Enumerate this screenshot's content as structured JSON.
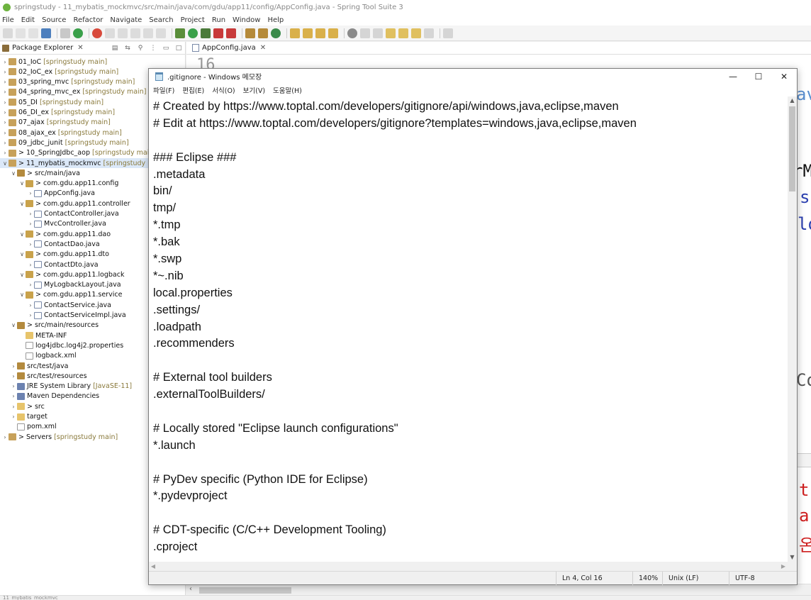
{
  "ide": {
    "title": "springstudy - 11_mybatis_mockmvc/src/main/java/com/gdu/app11/config/AppConfig.java - Spring Tool Suite 3",
    "menu": [
      "File",
      "Edit",
      "Source",
      "Refactor",
      "Navigate",
      "Search",
      "Project",
      "Run",
      "Window",
      "Help"
    ],
    "package_explorer": {
      "tab_label": "Package Explorer",
      "tree": [
        {
          "label": "01_IoC",
          "dec": "[springstudy main]",
          "type": "project",
          "depth": 0,
          "expanded": false
        },
        {
          "label": "02_IoC_ex",
          "dec": "[springstudy main]",
          "type": "project",
          "depth": 0,
          "expanded": false
        },
        {
          "label": "03_spring_mvc",
          "dec": "[springstudy main]",
          "type": "project",
          "depth": 0,
          "expanded": false
        },
        {
          "label": "04_spring_mvc_ex",
          "dec": "[springstudy main]",
          "type": "project",
          "depth": 0,
          "expanded": false
        },
        {
          "label": "05_DI",
          "dec": "[springstudy main]",
          "type": "project",
          "depth": 0,
          "expanded": false
        },
        {
          "label": "06_DI_ex",
          "dec": "[springstudy main]",
          "type": "project",
          "depth": 0,
          "expanded": false
        },
        {
          "label": "07_ajax",
          "dec": "[springstudy main]",
          "type": "project",
          "depth": 0,
          "expanded": false
        },
        {
          "label": "08_ajax_ex",
          "dec": "[springstudy main]",
          "type": "project",
          "depth": 0,
          "expanded": false
        },
        {
          "label": "09_jdbc_junit",
          "dec": "[springstudy main]",
          "type": "project",
          "depth": 0,
          "expanded": false
        },
        {
          "label": "> 10_SpringJdbc_aop",
          "dec": "[springstudy main]",
          "type": "project",
          "depth": 0,
          "expanded": false
        },
        {
          "label": "> 11_mybatis_mockmvc",
          "dec": "[springstudy main]",
          "type": "project",
          "depth": 0,
          "expanded": true,
          "selected": true
        },
        {
          "label": "> src/main/java",
          "dec": "",
          "type": "src",
          "depth": 1,
          "expanded": true
        },
        {
          "label": "> com.gdu.app11.config",
          "dec": "",
          "type": "pkg",
          "depth": 2,
          "expanded": true
        },
        {
          "label": "AppConfig.java",
          "dec": "",
          "type": "java",
          "depth": 3,
          "expanded": false
        },
        {
          "label": "> com.gdu.app11.controller",
          "dec": "",
          "type": "pkg",
          "depth": 2,
          "expanded": true
        },
        {
          "label": "ContactController.java",
          "dec": "",
          "type": "java",
          "depth": 3,
          "expanded": false
        },
        {
          "label": "MvcController.java",
          "dec": "",
          "type": "java",
          "depth": 3,
          "expanded": false
        },
        {
          "label": "> com.gdu.app11.dao",
          "dec": "",
          "type": "pkg",
          "depth": 2,
          "expanded": true
        },
        {
          "label": "ContactDao.java",
          "dec": "",
          "type": "java",
          "depth": 3,
          "expanded": false
        },
        {
          "label": "> com.gdu.app11.dto",
          "dec": "",
          "type": "pkg",
          "depth": 2,
          "expanded": true
        },
        {
          "label": "ContactDto.java",
          "dec": "",
          "type": "java",
          "depth": 3,
          "expanded": false
        },
        {
          "label": "> com.gdu.app11.logback",
          "dec": "",
          "type": "pkg",
          "depth": 2,
          "expanded": true
        },
        {
          "label": "MyLogbackLayout.java",
          "dec": "",
          "type": "java",
          "depth": 3,
          "expanded": false
        },
        {
          "label": "> com.gdu.app11.service",
          "dec": "",
          "type": "pkg",
          "depth": 2,
          "expanded": true
        },
        {
          "label": "ContactService.java",
          "dec": "",
          "type": "java",
          "depth": 3,
          "expanded": false
        },
        {
          "label": "ContactServiceImpl.java",
          "dec": "",
          "type": "java",
          "depth": 3,
          "expanded": false
        },
        {
          "label": "> src/main/resources",
          "dec": "",
          "type": "src",
          "depth": 1,
          "expanded": true
        },
        {
          "label": "META-INF",
          "dec": "",
          "type": "folder",
          "depth": 2,
          "leaf": true
        },
        {
          "label": "log4jdbc.log4j2.properties",
          "dec": "",
          "type": "file",
          "depth": 2,
          "leaf": true
        },
        {
          "label": "logback.xml",
          "dec": "",
          "type": "file",
          "depth": 2,
          "leaf": true
        },
        {
          "label": "src/test/java",
          "dec": "",
          "type": "src",
          "depth": 1,
          "expanded": false
        },
        {
          "label": "src/test/resources",
          "dec": "",
          "type": "src",
          "depth": 1,
          "expanded": false
        },
        {
          "label": "JRE System Library",
          "dec": "[JavaSE-11]",
          "type": "lib",
          "depth": 1,
          "expanded": false
        },
        {
          "label": "Maven Dependencies",
          "dec": "",
          "type": "lib",
          "depth": 1,
          "expanded": false
        },
        {
          "label": "> src",
          "dec": "",
          "type": "folder",
          "depth": 1,
          "expanded": false
        },
        {
          "label": "target",
          "dec": "",
          "type": "folder",
          "depth": 1,
          "expanded": false
        },
        {
          "label": "pom.xml",
          "dec": "",
          "type": "file",
          "depth": 1,
          "leaf": true
        },
        {
          "label": "> Servers",
          "dec": "[springstudy main]",
          "type": "project",
          "depth": 0,
          "expanded": false
        }
      ]
    },
    "editor": {
      "tab_label": "AppConfig.java",
      "line_number": "16",
      "fragments": [
        "av",
        "rM",
        "s",
        "lo",
        "Co",
        "t",
        "a",
        "온"
      ]
    },
    "status_text": "11_mybatis_mockmvc"
  },
  "notepad": {
    "title": ".gitignore - Windows 메모장",
    "menu": [
      "파일(F)",
      "편집(E)",
      "서식(O)",
      "보기(V)",
      "도움말(H)"
    ],
    "lines": [
      "# Created by https://www.toptal.com/developers/gitignore/api/windows,java,eclipse,maven",
      "# Edit at https://www.toptal.com/developers/gitignore?templates=windows,java,eclipse,maven",
      "",
      "### Eclipse ###",
      ".metadata",
      "bin/",
      "tmp/",
      "*.tmp",
      "*.bak",
      "*.swp",
      "*~.nib",
      "local.properties",
      ".settings/",
      ".loadpath",
      ".recommenders",
      "",
      "# External tool builders",
      ".externalToolBuilders/",
      "",
      "# Locally stored \"Eclipse launch configurations\"",
      "*.launch",
      "",
      "# PyDev specific (Python IDE for Eclipse)",
      "*.pydevproject",
      "",
      "# CDT-specific (C/C++ Development Tooling)",
      ".cproject"
    ],
    "status": {
      "position": "Ln 4, Col 16",
      "zoom": "140%",
      "line_ending": "Unix (LF)",
      "encoding": "UTF-8"
    }
  }
}
